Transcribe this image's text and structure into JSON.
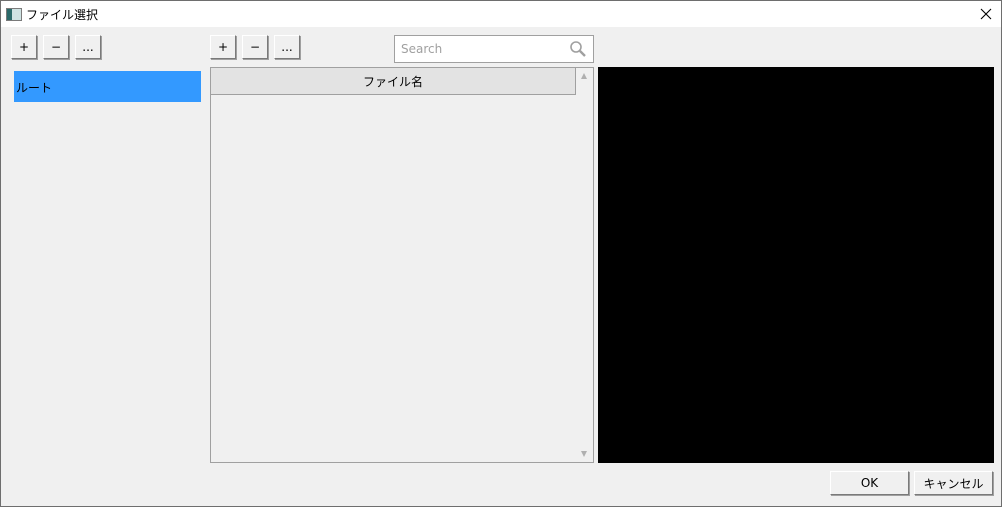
{
  "window": {
    "title": "ファイル選択",
    "close_icon": "close-icon"
  },
  "left_toolbar": {
    "add": "+",
    "remove": "−",
    "more": "..."
  },
  "tree": {
    "items": [
      {
        "label": "ルート",
        "selected": true
      }
    ]
  },
  "mid_toolbar": {
    "add": "+",
    "remove": "−",
    "more": "..."
  },
  "search": {
    "placeholder": "Search",
    "icon": "search-icon"
  },
  "file_list": {
    "columns": [
      "ファイル名"
    ],
    "rows": []
  },
  "footer": {
    "ok": "OK",
    "cancel": "キャンセル"
  },
  "colors": {
    "selection": "#3399ff",
    "preview_bg": "#000000"
  }
}
